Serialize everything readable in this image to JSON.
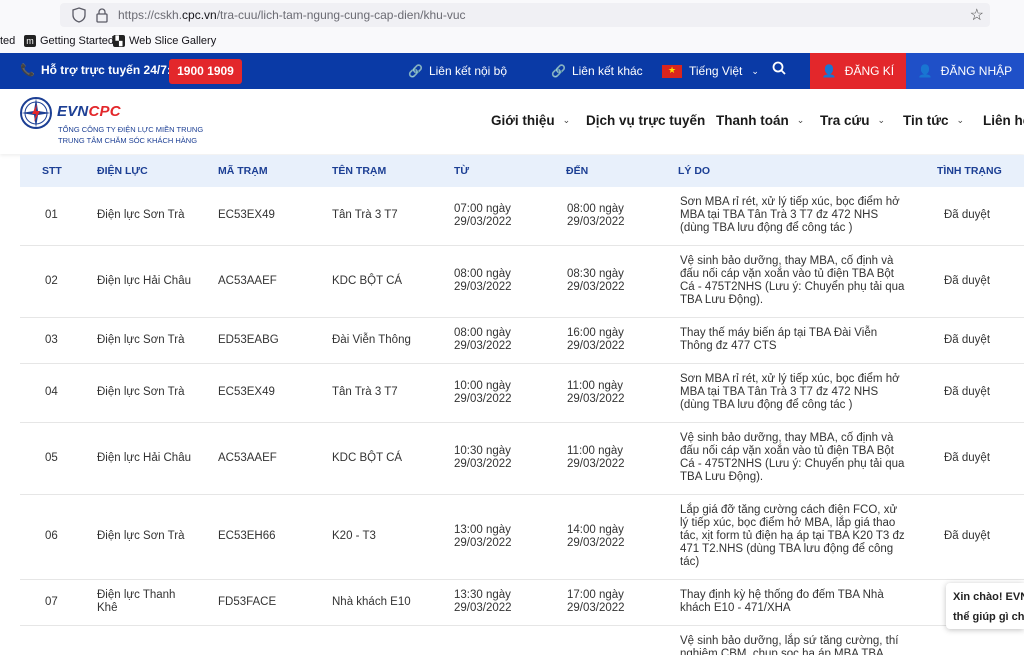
{
  "browser": {
    "url_prefix": "https://cskh.",
    "url_domain": "cpc.vn",
    "url_suffix": "/tra-cuu/lich-tam-ngung-cung-cap-dien/khu-vuc",
    "bookmarks": [
      {
        "label": "ted"
      },
      {
        "label": "Getting Started"
      },
      {
        "label": "Web Slice Gallery"
      }
    ]
  },
  "topbar": {
    "support_label": "Hỗ trợ trực tuyến 24/7:",
    "hotline": "1900 1909",
    "internal_links": "Liên kết nội bộ",
    "other_links": "Liên kết khác",
    "language": "Tiếng Việt",
    "register": "ĐĂNG KÍ",
    "login": "ĐĂNG NHẬP",
    "colors": {
      "bar": "#0a3aa6",
      "accent": "#e3272b",
      "login_bg": "#1f50c8"
    }
  },
  "logo": {
    "evn": "EVN",
    "cpc": "CPC",
    "line1": "TỔNG CÔNG TY ĐIỆN LỰC MIỀN TRUNG",
    "line2": "TRUNG TÂM CHĂM SÓC KHÁCH HÀNG"
  },
  "nav": {
    "items": [
      {
        "label": "Giới thiệu"
      },
      {
        "label": "Dịch vụ trực tuyến"
      },
      {
        "label": "Thanh toán"
      },
      {
        "label": "Tra cứu"
      },
      {
        "label": "Tin tức"
      },
      {
        "label": "Liên hệ"
      }
    ]
  },
  "table": {
    "headers": {
      "stt": "STT",
      "dienluc": "ĐIỆN LỰC",
      "matram": "MÃ TRẠM",
      "tentram": "TÊN TRẠM",
      "tu": "TỪ",
      "den": "ĐẾN",
      "lydo": "LÝ DO",
      "tinhtrang": "TÌNH TRẠNG"
    },
    "rows": [
      {
        "stt": "01",
        "dienluc": "Điện lực Sơn Trà",
        "matram": "EC53EX49",
        "tentram": "Tân Trà 3 T7",
        "tu_time": "07:00 ngày",
        "tu_date": "29/03/2022",
        "den_time": "08:00 ngày",
        "den_date": "29/03/2022",
        "lydo": "Sơn MBA rỉ rét, xử lý tiếp xúc, bọc điểm hở MBA tại TBA Tân Trà 3 T7 đz 472 NHS (dùng TBA lưu động để công tác )",
        "tinhtrang": "Đã duyệt"
      },
      {
        "stt": "02",
        "dienluc": "Điện lực Hải Châu",
        "matram": "AC53AAEF",
        "tentram": "KDC BỘT CÁ",
        "tu_time": "08:00 ngày",
        "tu_date": "29/03/2022",
        "den_time": "08:30 ngày",
        "den_date": "29/03/2022",
        "lydo": "Vệ sinh bảo dưỡng, thay MBA, cố định và đấu nối cáp vặn xoắn vào tủ điện TBA Bột Cá - 475T2NHS (Lưu ý: Chuyển phụ tải qua TBA Lưu Động).",
        "tinhtrang": "Đã duyệt"
      },
      {
        "stt": "03",
        "dienluc": "Điện lực Sơn Trà",
        "matram": "ED53EABG",
        "tentram": "Đài Viễn Thông",
        "tu_time": "08:00 ngày",
        "tu_date": "29/03/2022",
        "den_time": "16:00 ngày",
        "den_date": "29/03/2022",
        "lydo": "Thay thế máy biến áp tại TBA Đài Viễn Thông đz 477 CTS",
        "tinhtrang": "Đã duyệt"
      },
      {
        "stt": "04",
        "dienluc": "Điện lực Sơn Trà",
        "matram": "EC53EX49",
        "tentram": "Tân Trà 3 T7",
        "tu_time": "10:00 ngày",
        "tu_date": "29/03/2022",
        "den_time": "11:00 ngày",
        "den_date": "29/03/2022",
        "lydo": "Sơn MBA rỉ rét, xử lý tiếp xúc, bọc điểm hở MBA tại TBA Tân Trà 3 T7 đz 472 NHS (dùng TBA lưu động để công tác )",
        "tinhtrang": "Đã duyệt"
      },
      {
        "stt": "05",
        "dienluc": "Điện lực Hải Châu",
        "matram": "AC53AAEF",
        "tentram": "KDC BỘT CÁ",
        "tu_time": "10:30 ngày",
        "tu_date": "29/03/2022",
        "den_time": "11:00 ngày",
        "den_date": "29/03/2022",
        "lydo": "Vệ sinh bảo dưỡng, thay MBA, cố định và đấu nối cáp vặn xoắn vào tủ điện TBA Bột Cá - 475T2NHS (Lưu ý: Chuyển phụ tải qua TBA Lưu Động).",
        "tinhtrang": "Đã duyệt"
      },
      {
        "stt": "06",
        "dienluc": "Điện lực Sơn Trà",
        "matram": "EC53EH66",
        "tentram": "K20 - T3",
        "tu_time": "13:00 ngày",
        "tu_date": "29/03/2022",
        "den_time": "14:00 ngày",
        "den_date": "29/03/2022",
        "lydo": "Lắp giá đỡ tăng cường cách điện FCO, xử lý tiếp xúc, bọc điểm hở MBA, lắp giá thao tác, xịt form tủ điện hạ áp tại TBA K20 T3 đz 471 T2.NHS (dùng TBA lưu động để công tác)",
        "tinhtrang": "Đã duyệt"
      },
      {
        "stt": "07",
        "dienluc": "Điện lực Thanh Khê",
        "matram": "FD53FACE",
        "tentram": "Nhà khách E10",
        "tu_time": "13:30 ngày",
        "tu_date": "29/03/2022",
        "den_time": "17:00 ngày",
        "den_date": "29/03/2022",
        "lydo": "Thay định kỳ hệ thống đo đếm TBA Nhà khách E10 - 471/XHA",
        "tinhtrang": ""
      },
      {
        "stt": "",
        "dienluc": "",
        "matram": "",
        "tentram": "",
        "tu_time": "",
        "tu_date": "",
        "den_time": "",
        "den_date": "",
        "lydo": "Vệ sinh bảo dưỡng, lắp sứ tăng cường, thí nghiệm CBM, chụp sọc hạ áp MBA TBA",
        "tinhtrang": ""
      }
    ]
  },
  "chat": {
    "line1": "Xin chào! EVN",
    "line2": "thể giúp gì ch"
  }
}
